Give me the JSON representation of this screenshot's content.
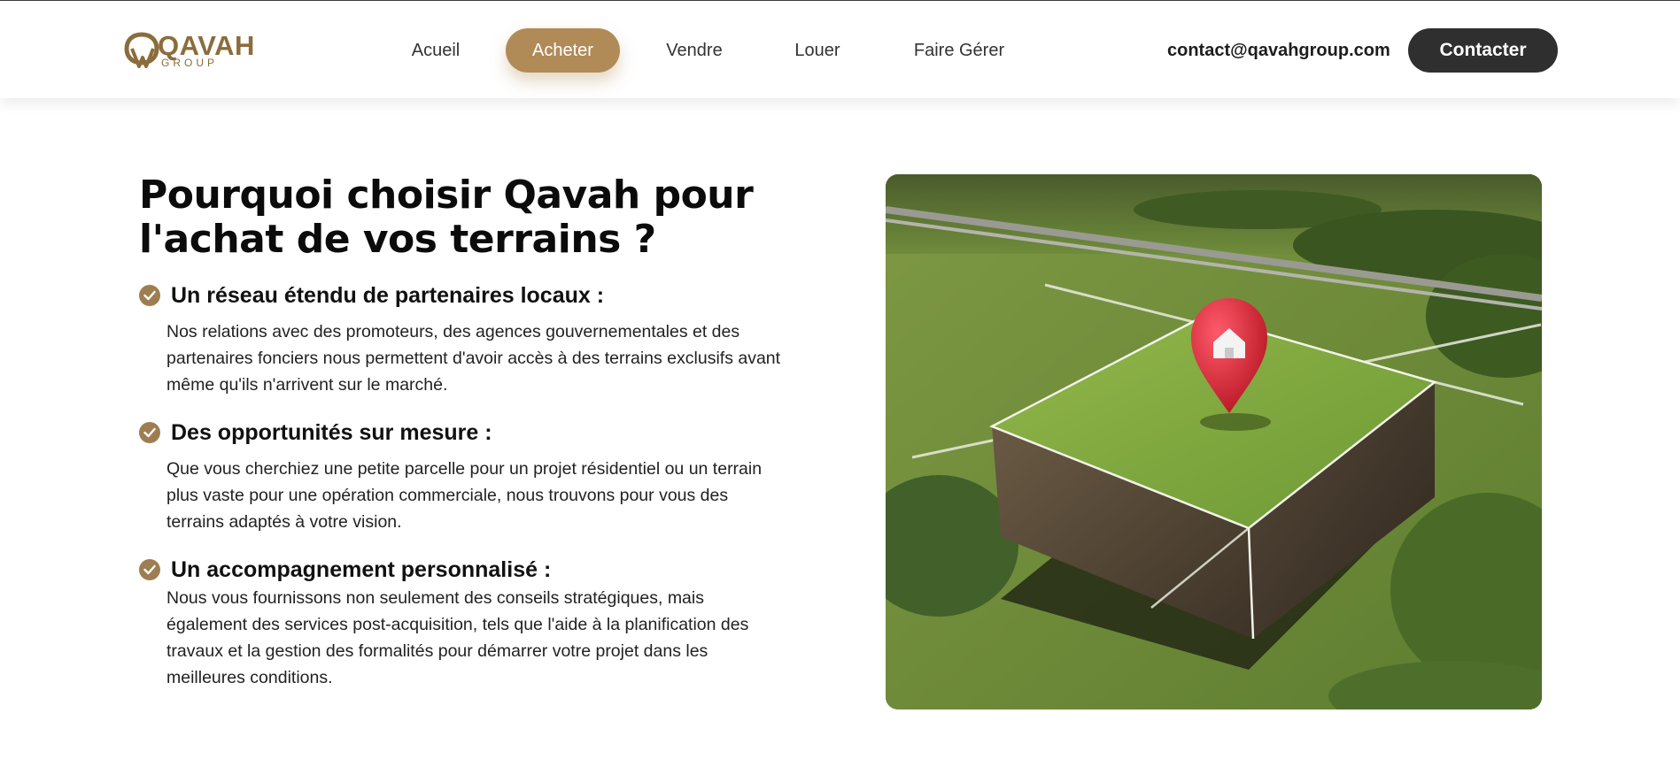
{
  "brand": {
    "name": "QAVAH",
    "sub": "GROUP",
    "color": "#8b6d3c"
  },
  "nav": {
    "items": [
      {
        "label": "Acueil",
        "active": false
      },
      {
        "label": "Acheter",
        "active": true
      },
      {
        "label": "Vendre",
        "active": false
      },
      {
        "label": "Louer",
        "active": false
      },
      {
        "label": "Faire Gérer",
        "active": false
      }
    ]
  },
  "header": {
    "email": "contact@qavahgroup.com",
    "contact_label": "Contacter"
  },
  "main": {
    "title_line1": "Pourquoi choisir Qavah pour",
    "title_line2": "l'achat de vos terrains ?",
    "features": [
      {
        "title": "Un réseau étendu de partenaires locaux :",
        "lines": [
          "Nos relations avec des promoteurs, des agences gouvernementales et des",
          "partenaires fonciers nous permettent d'avoir accès à des terrains exclusifs avant",
          "même qu'ils n'arrivent sur le marché."
        ]
      },
      {
        "title": "Des opportunités sur mesure :",
        "lines": [
          "Que vous cherchiez une petite parcelle pour un projet résidentiel ou un terrain",
          "plus vaste pour une opération commerciale, nous trouvons pour vous des",
          "terrains adaptés à votre vision."
        ]
      },
      {
        "title": "Un accompagnement personnalisé :",
        "lines": [
          "Nous vous fournissons non seulement des conseils stratégiques, mais",
          "également des services post-acquisition, tels que l'aide à la planification des",
          "travaux et la gestion des formalités pour démarrer votre projet dans les",
          "meilleures conditions."
        ]
      }
    ],
    "check_icon": "check-circle-icon",
    "accent_color": "#b08b57"
  },
  "image": {
    "subject": "land-plot-location-pin-illustration",
    "pin_icon": "house-pin-icon"
  }
}
